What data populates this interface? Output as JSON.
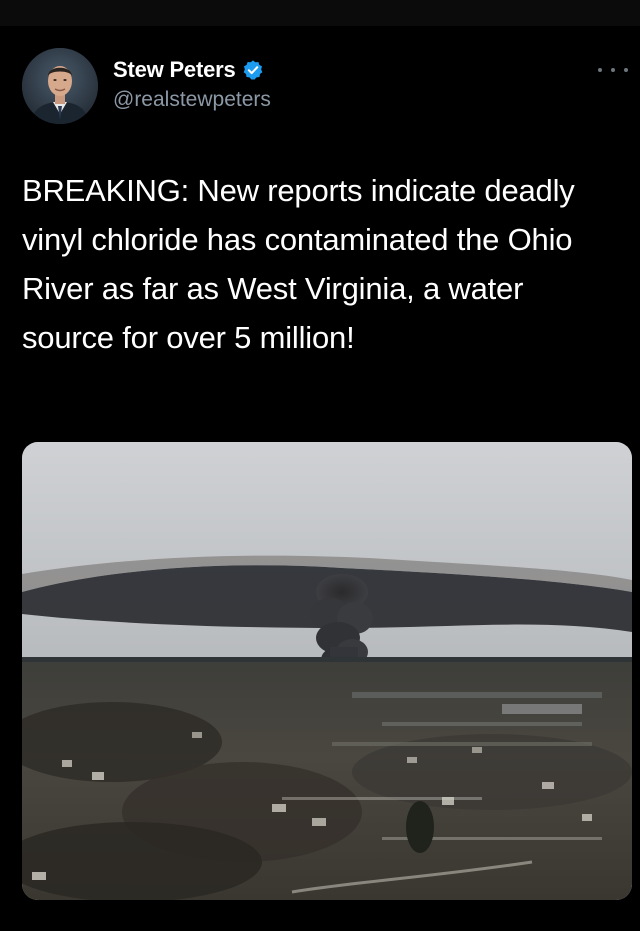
{
  "tweet": {
    "author": {
      "display_name": "Stew Peters",
      "handle": "@realstewpeters",
      "verified": true,
      "avatar_icon": "user-avatar-photo"
    },
    "menu_icon": "more-options-icon",
    "text": "BREAKING: New reports indicate deadly vinyl chloride has contaminated the Ohio River as far as West Virginia, a water source for over 5 million!",
    "media": {
      "type": "photo",
      "subject": "aerial-town-smoke-plume-photo"
    }
  },
  "colors": {
    "background": "#000000",
    "primary_text": "#ffffff",
    "secondary_text": "#8b98a5",
    "verified_badge": "#1d9bf0"
  }
}
